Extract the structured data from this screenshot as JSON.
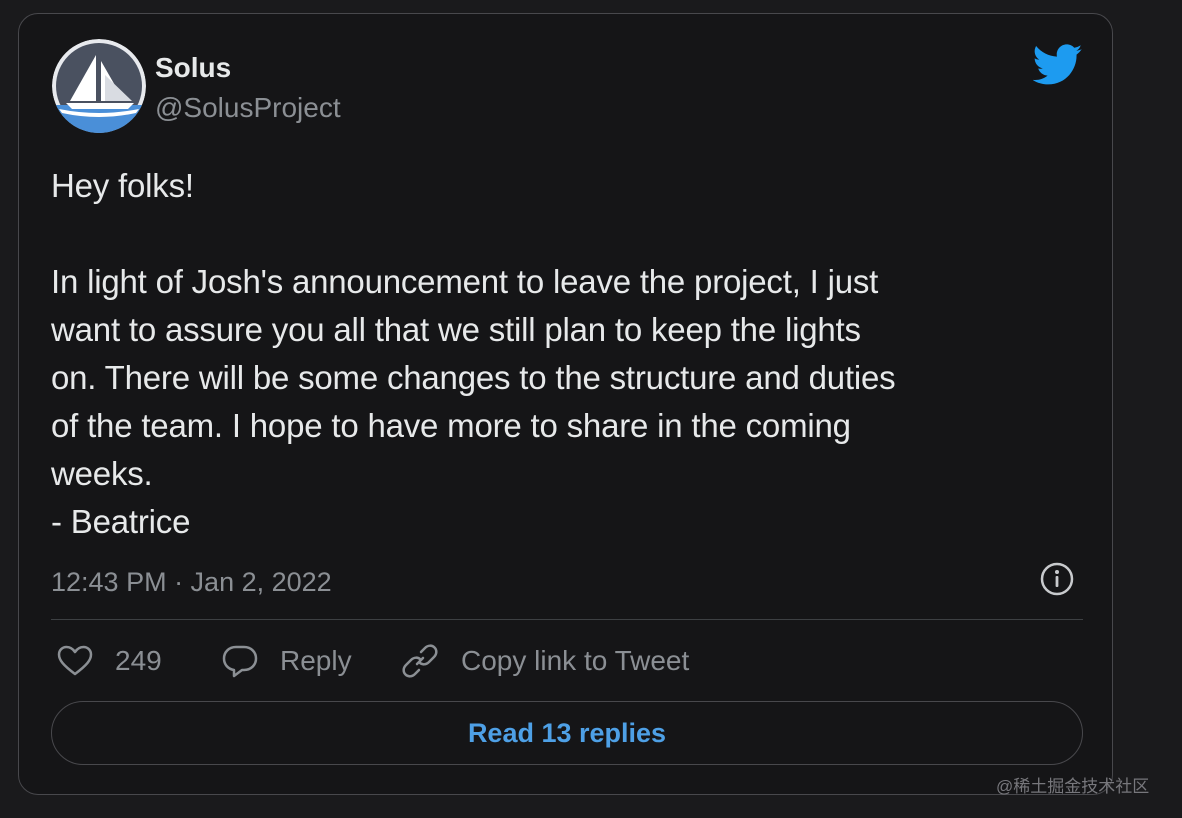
{
  "author": {
    "name": "Solus",
    "handle": "@SolusProject",
    "avatar_icon": "solus-sailboat-logo"
  },
  "tweet": {
    "text": "Hey folks!\n\nIn light of Josh's announcement to leave the project, I just\nwant to assure you all that we still plan to keep the lights\non. There will be some changes to the structure and duties\nof the team. I hope to have more to share in the coming\nweeks.\n- Beatrice",
    "timestamp": "12:43 PM · Jan 2, 2022"
  },
  "actions": {
    "like_count": "249",
    "reply_label": "Reply",
    "copy_label": "Copy link to Tweet"
  },
  "read_replies_label": "Read 13 replies",
  "watermark": "@稀土掘金技术社区",
  "colors": {
    "background": "#151517",
    "border": "#48484c",
    "text": "#e7e9ea",
    "muted": "#8b8f94",
    "twitter_blue": "#1d9bf0",
    "link_blue": "#4ea0e6"
  },
  "icons": [
    "twitter-bird-icon",
    "info-icon",
    "heart-icon",
    "reply-bubble-icon",
    "link-icon"
  ]
}
